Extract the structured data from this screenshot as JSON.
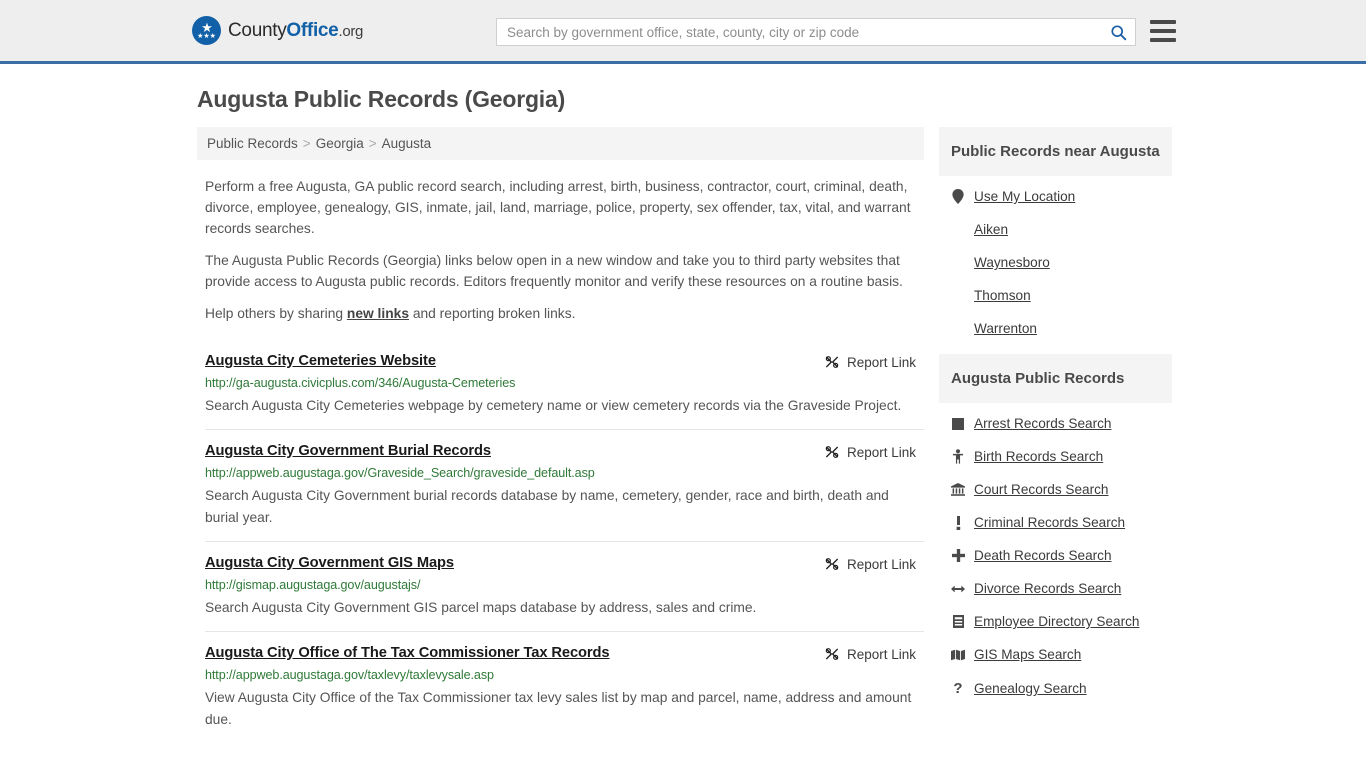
{
  "header": {
    "logo": {
      "text_1": "County",
      "text_2": "Office",
      "text_3": ".org",
      "icon": "eagle-seal-icon"
    },
    "search": {
      "placeholder": "Search by government office, state, county, city or zip code",
      "value": "",
      "icon": "search-icon"
    },
    "menu_icon": "hamburger-menu-icon",
    "accent_color": "#3a6ea5"
  },
  "page": {
    "title": "Augusta Public Records (Georgia)"
  },
  "breadcrumb": {
    "items": [
      "Public Records",
      "Georgia",
      "Augusta"
    ],
    "separator": ">"
  },
  "intro": {
    "paragraph_1": "Perform a free Augusta, GA public record search, including arrest, birth, business, contractor, court, criminal, death, divorce, employee, genealogy, GIS, inmate, jail, land, marriage, police, property, sex offender, tax, vital, and warrant records searches.",
    "paragraph_2": "The Augusta Public Records (Georgia) links below open in a new window and take you to third party websites that provide access to Augusta public records. Editors frequently monitor and verify these resources on a routine basis.",
    "paragraph_3_before": "Help others by sharing ",
    "paragraph_3_link": "new links",
    "paragraph_3_after": " and reporting broken links."
  },
  "results": {
    "report_label": "Report Link",
    "report_icon": "broken-link-icon",
    "items": [
      {
        "title": "Augusta City Cemeteries Website",
        "url": "http://ga-augusta.civicplus.com/346/Augusta-Cemeteries",
        "description": "Search Augusta City Cemeteries webpage by cemetery name or view cemetery records via the Graveside Project."
      },
      {
        "title": "Augusta City Government Burial Records",
        "url": "http://appweb.augustaga.gov/Graveside_Search/graveside_default.asp",
        "description": "Search Augusta City Government burial records database by name, cemetery, gender, race and birth, death and burial year."
      },
      {
        "title": "Augusta City Government GIS Maps",
        "url": "http://gismap.augustaga.gov/augustajs/",
        "description": "Search Augusta City Government GIS parcel maps database by address, sales and crime."
      },
      {
        "title": "Augusta City Office of The Tax Commissioner Tax Records",
        "url": "http://appweb.augustaga.gov/taxlevy/taxlevysale.asp",
        "description": "View Augusta City Office of the Tax Commissioner tax levy sales list by map and parcel, name, address and amount due."
      }
    ]
  },
  "sidebar": {
    "nearby": {
      "heading": "Public Records near Augusta",
      "items": [
        {
          "label": "Use My Location",
          "icon": "map-pin-icon",
          "glyph": "•"
        },
        {
          "label": "Aiken",
          "icon": "",
          "glyph": ""
        },
        {
          "label": "Waynesboro",
          "icon": "",
          "glyph": ""
        },
        {
          "label": "Thomson",
          "icon": "",
          "glyph": ""
        },
        {
          "label": "Warrenton",
          "icon": "",
          "glyph": ""
        }
      ]
    },
    "records": {
      "heading": "Augusta Public Records",
      "items": [
        {
          "label": "Arrest Records Search",
          "icon": "square-icon",
          "glyph": "■"
        },
        {
          "label": "Birth Records Search",
          "icon": "baby-icon",
          "glyph": "♁"
        },
        {
          "label": "Court Records Search",
          "icon": "courthouse-icon",
          "glyph": "ἽB"
        },
        {
          "label": "Criminal Records Search",
          "icon": "exclamation-icon",
          "glyph": "!"
        },
        {
          "label": "Death Records Search",
          "icon": "plus-cross-icon",
          "glyph": "✚"
        },
        {
          "label": "Divorce Records Search",
          "icon": "left-right-arrow-icon",
          "glyph": "↔"
        },
        {
          "label": "Employee Directory Search",
          "icon": "id-card-icon",
          "glyph": "▤"
        },
        {
          "label": "GIS Maps Search",
          "icon": "map-icon",
          "glyph": "ὟA"
        },
        {
          "label": "Genealogy Search",
          "icon": "question-mark-icon",
          "glyph": "?"
        }
      ]
    }
  }
}
